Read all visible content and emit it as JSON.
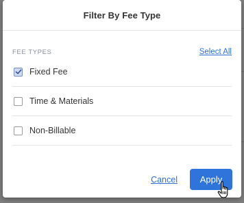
{
  "modal": {
    "title": "Filter By Fee Type",
    "section_label": "FEE TYPES",
    "select_all_label": "Select All",
    "options": [
      {
        "label": "Fixed Fee",
        "checked": true
      },
      {
        "label": "Time & Materials",
        "checked": false
      },
      {
        "label": "Non-Billable",
        "checked": false
      }
    ],
    "cancel_label": "Cancel",
    "apply_label": "Apply"
  },
  "colors": {
    "accent": "#2f74db",
    "link": "#2f6fd6",
    "overlay": "#808080"
  },
  "icons": [
    "checkmark-icon",
    "hand-pointer-cursor-icon"
  ]
}
